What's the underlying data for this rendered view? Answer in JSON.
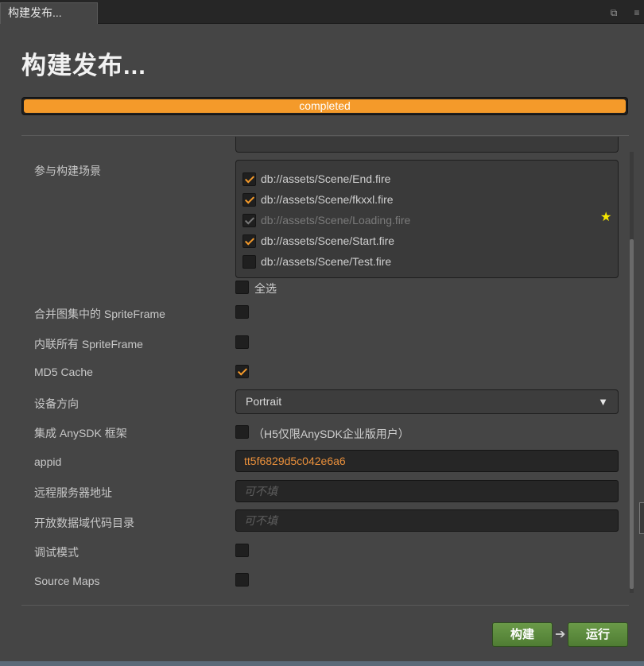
{
  "window": {
    "tab_title": "构建发布...",
    "restore_glyph": "⧉",
    "menu_glyph": "≡"
  },
  "header": {
    "title": "构建发布..."
  },
  "progress": {
    "text": "completed",
    "value": 1.0,
    "color": "#f49a2a"
  },
  "scenes": {
    "label": "参与构建场景",
    "items": [
      {
        "path": "db://assets/Scene/End.fire",
        "checked": true
      },
      {
        "path": "db://assets/Scene/fkxxl.fire",
        "checked": true
      },
      {
        "path": "db://assets/Scene/Loading.fire",
        "checked": true,
        "disabled": true,
        "start_scene": true
      },
      {
        "path": "db://assets/Scene/Start.fire",
        "checked": true
      },
      {
        "path": "db://assets/Scene/Test.fire",
        "checked": false
      }
    ],
    "star_glyph": "★",
    "select_all_label": "全选",
    "select_all_checked": false
  },
  "options": {
    "merge_spriteframe_label": "合并图集中的 SpriteFrame",
    "merge_spriteframe_checked": false,
    "inline_spriteframe_label": "内联所有 SpriteFrame",
    "inline_spriteframe_checked": false,
    "md5_label": "MD5 Cache",
    "md5_checked": true,
    "orientation_label": "设备方向",
    "orientation_value": "Portrait",
    "orientation_arrow": "▼",
    "anysdk_label": "集成 AnySDK 框架",
    "anysdk_checked": false,
    "anysdk_note": "（H5仅限AnySDK企业版用户）",
    "appid_label": "appid",
    "appid_value": "tt5f6829d5c042e6a6",
    "remote_server_label": "远程服务器地址",
    "remote_server_placeholder": "可不填",
    "open_data_label": "开放数据域代码目录",
    "open_data_placeholder": "可不填",
    "debug_label": "调试模式",
    "debug_checked": false,
    "source_maps_label": "Source Maps",
    "source_maps_checked": false
  },
  "footer": {
    "build_label": "构建",
    "arrow_glyph": "➔",
    "run_label": "运行",
    "button_color": "#5e8c3f"
  }
}
